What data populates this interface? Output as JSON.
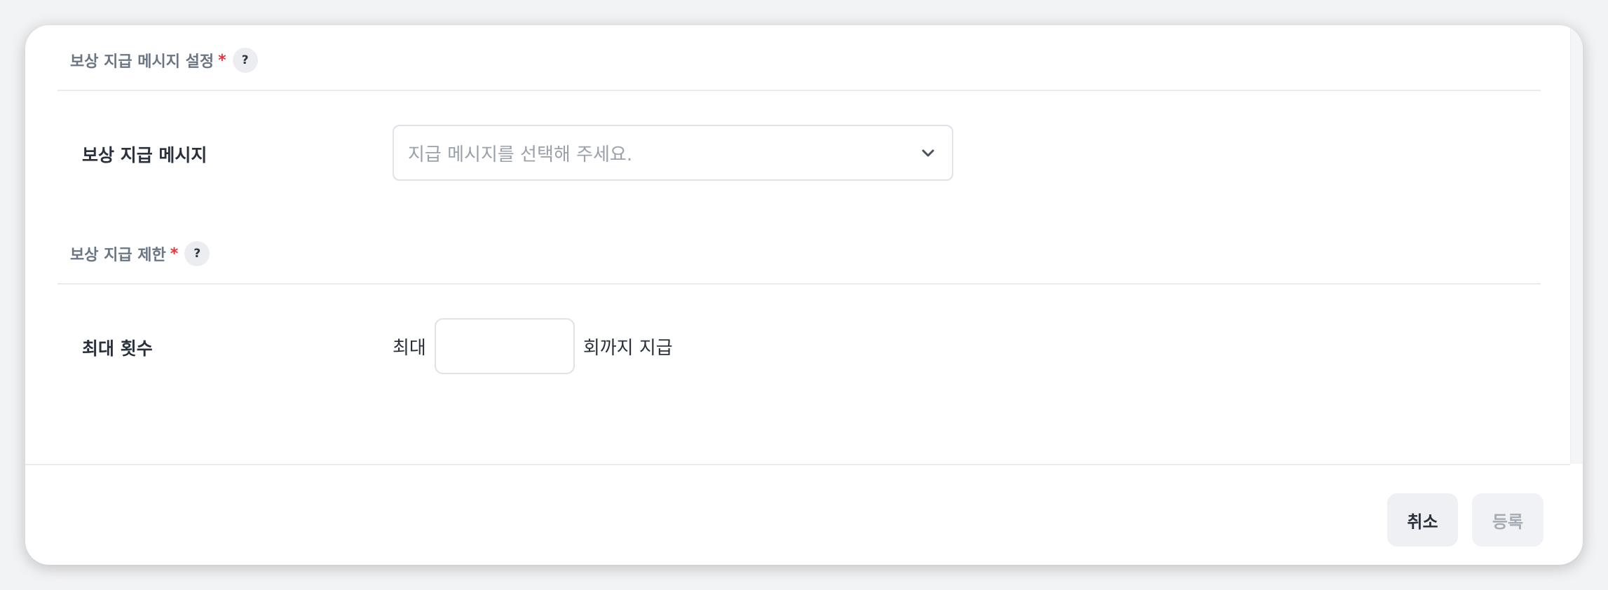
{
  "reward_message_section": {
    "title": "보상 지급 메시지 설정",
    "required_mark": "*",
    "help_label": "?",
    "field_label": "보상 지급 메시지",
    "select_placeholder": "지급 메시지를 선택해 주세요."
  },
  "reward_limit_section": {
    "title": "보상 지급 제한",
    "required_mark": "*",
    "help_label": "?",
    "field_label": "최대 횟수",
    "prefix": "최대",
    "input_value": "",
    "suffix": "회까지 지급"
  },
  "footer": {
    "cancel_label": "취소",
    "submit_label": "등록"
  },
  "colors": {
    "required": "#e5343f",
    "label": "#2a313c",
    "section_title": "#6b7584",
    "placeholder": "#9aa1ab",
    "disabled_text": "#a6acb5"
  },
  "icons": {
    "help": "question-circle-icon",
    "select_arrow": "chevron-down-icon"
  }
}
